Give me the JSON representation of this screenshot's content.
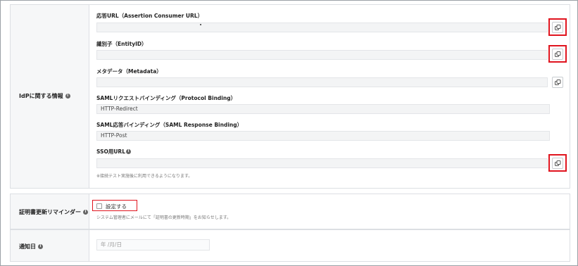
{
  "idp_section": {
    "label": "IdPに関する情報",
    "fields": [
      {
        "label": "応答URL（Assertion Consumer URL）",
        "value": ""
      },
      {
        "label": "識別子（EntityID）",
        "value": ""
      },
      {
        "label": "メタデータ（Metadata）",
        "value": ""
      },
      {
        "label": "SAMLリクエストバインディング（Protocol Binding）",
        "value": "HTTP-Redirect"
      },
      {
        "label": "SAML応答バインディング（SAML Response Binding）",
        "value": "HTTP-Post"
      },
      {
        "label": "SSO用URL",
        "value": ""
      }
    ],
    "note": "※接続テスト実施後に利用できるようになります。"
  },
  "reminder_section": {
    "label": "証明書更新リマインダー",
    "checkbox_label": "設定する",
    "description": "システム管理者にメールにて「証明書の更新時期」をお知らせします。"
  },
  "notify_section": {
    "label": "通知日",
    "date_placeholder": "年 /月/日"
  },
  "icons": {
    "copy": "copy-icon",
    "info": "info-icon"
  },
  "colors": {
    "highlight": "#e0141e",
    "label_bg": "#f6f7f8"
  }
}
